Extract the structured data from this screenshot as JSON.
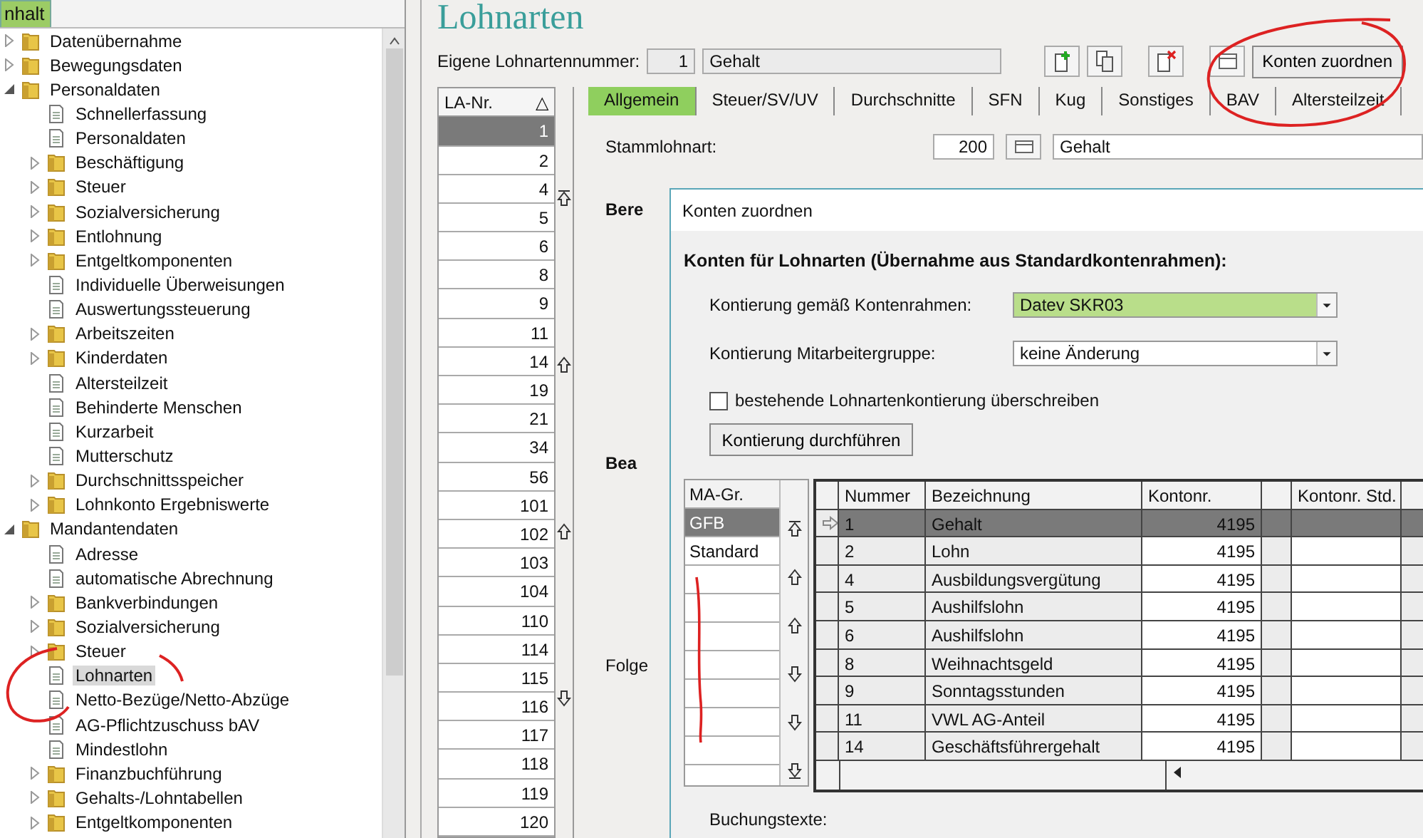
{
  "sidebar": {
    "tab": "nhalt",
    "items": [
      {
        "label": "Datenübernahme",
        "kind": "folder",
        "expanded": false,
        "selected": false
      },
      {
        "label": "Bewegungsdaten",
        "kind": "folder",
        "expanded": false,
        "selected": false
      },
      {
        "label": "Personaldaten",
        "kind": "folder",
        "expanded": true,
        "selected": false,
        "children": [
          {
            "label": "Schnellerfassung",
            "kind": "page",
            "selected": false
          },
          {
            "label": "Personaldaten",
            "kind": "page",
            "selected": false
          },
          {
            "label": "Beschäftigung",
            "kind": "folder",
            "expanded": false,
            "selected": false
          },
          {
            "label": "Steuer",
            "kind": "folder",
            "expanded": false,
            "selected": false
          },
          {
            "label": "Sozialversicherung",
            "kind": "folder",
            "expanded": false,
            "selected": false
          },
          {
            "label": "Entlohnung",
            "kind": "folder",
            "expanded": false,
            "selected": false
          },
          {
            "label": "Entgeltkomponenten",
            "kind": "folder",
            "expanded": false,
            "selected": false
          },
          {
            "label": "Individuelle Überweisungen",
            "kind": "page",
            "selected": false
          },
          {
            "label": "Auswertungssteuerung",
            "kind": "page",
            "selected": false
          },
          {
            "label": "Arbeitszeiten",
            "kind": "folder",
            "expanded": false,
            "selected": false
          },
          {
            "label": "Kinderdaten",
            "kind": "folder",
            "expanded": false,
            "selected": false
          },
          {
            "label": "Altersteilzeit",
            "kind": "page",
            "selected": false
          },
          {
            "label": "Behinderte Menschen",
            "kind": "page",
            "selected": false
          },
          {
            "label": "Kurzarbeit",
            "kind": "page",
            "selected": false
          },
          {
            "label": "Mutterschutz",
            "kind": "page",
            "selected": false
          },
          {
            "label": "Durchschnittsspeicher",
            "kind": "folder",
            "expanded": false,
            "selected": false
          },
          {
            "label": "Lohnkonto Ergebniswerte",
            "kind": "folder",
            "expanded": false,
            "selected": false
          }
        ]
      },
      {
        "label": "Mandantendaten",
        "kind": "folder",
        "expanded": true,
        "selected": false,
        "children": [
          {
            "label": "Adresse",
            "kind": "page",
            "selected": false
          },
          {
            "label": "automatische Abrechnung",
            "kind": "page",
            "selected": false
          },
          {
            "label": "Bankverbindungen",
            "kind": "folder",
            "expanded": false,
            "selected": false
          },
          {
            "label": "Sozialversicherung",
            "kind": "folder",
            "expanded": false,
            "selected": false
          },
          {
            "label": "Steuer",
            "kind": "folder",
            "expanded": false,
            "selected": false
          },
          {
            "label": "Lohnarten",
            "kind": "page",
            "selected": true
          },
          {
            "label": "Netto-Bezüge/Netto-Abzüge",
            "kind": "page",
            "selected": false
          },
          {
            "label": "AG-Pflichtzuschuss bAV",
            "kind": "page",
            "selected": false
          },
          {
            "label": "Mindestlohn",
            "kind": "page",
            "selected": false
          },
          {
            "label": "Finanzbuchführung",
            "kind": "folder",
            "expanded": false,
            "selected": false
          },
          {
            "label": "Gehalts-/Lohntabellen",
            "kind": "folder",
            "expanded": false,
            "selected": false
          },
          {
            "label": "Entgeltkomponenten",
            "kind": "folder",
            "expanded": false,
            "selected": false
          }
        ]
      }
    ]
  },
  "title": "Lohnarten",
  "header": {
    "number_label": "Eigene Lohnartennummer:",
    "number": "1",
    "name": "Gehalt",
    "assign_button": "Konten zuordnen"
  },
  "la_list": {
    "header": "LA-Nr.",
    "sort_icon": "△",
    "items": [
      {
        "label": "1",
        "selected": true
      },
      {
        "label": "2",
        "selected": false
      },
      {
        "label": "4",
        "selected": false
      },
      {
        "label": "5",
        "selected": false
      },
      {
        "label": "6",
        "selected": false
      },
      {
        "label": "8",
        "selected": false
      },
      {
        "label": "9",
        "selected": false
      },
      {
        "label": "11",
        "selected": false
      },
      {
        "label": "14",
        "selected": false
      },
      {
        "label": "19",
        "selected": false
      },
      {
        "label": "21",
        "selected": false
      },
      {
        "label": "34",
        "selected": false
      },
      {
        "label": "56",
        "selected": false
      },
      {
        "label": "101",
        "selected": false
      },
      {
        "label": "102",
        "selected": false
      },
      {
        "label": "103",
        "selected": false
      },
      {
        "label": "104",
        "selected": false
      },
      {
        "label": "110",
        "selected": false
      },
      {
        "label": "114",
        "selected": false
      },
      {
        "label": "115",
        "selected": false
      },
      {
        "label": "116",
        "selected": false
      },
      {
        "label": "117",
        "selected": false
      },
      {
        "label": "118",
        "selected": false
      },
      {
        "label": "119",
        "selected": false
      },
      {
        "label": "120",
        "selected": false
      }
    ]
  },
  "tabs": [
    {
      "label": "Allgemein",
      "selected": true
    },
    {
      "label": "Steuer/SV/UV",
      "selected": false
    },
    {
      "label": "Durchschnitte",
      "selected": false
    },
    {
      "label": "SFN",
      "selected": false
    },
    {
      "label": "Kug",
      "selected": false
    },
    {
      "label": "Sonstiges",
      "selected": false
    },
    {
      "label": "BAV",
      "selected": false
    },
    {
      "label": "Altersteilzeit",
      "selected": false
    }
  ],
  "general": {
    "base_label": "Stammlohnart:",
    "base_number": "200",
    "base_name": "Gehalt",
    "section_1": "Bere",
    "section_2": "Bea",
    "section_3": "Folge"
  },
  "dialog": {
    "title": "Konten zuordnen",
    "heading": "Konten für Lohnarten (Übernahme aus Standardkontenrahmen):",
    "fields": [
      {
        "label": "Kontierung gemäß Kontenrahmen:",
        "value": "Datev SKR03",
        "highlighted": true
      },
      {
        "label": "Kontierung Mitarbeitergruppe:",
        "value": "keine Änderung",
        "highlighted": false
      }
    ],
    "overwrite": {
      "label": "bestehende Lohnartenkontierung überschreiben",
      "checked": false
    },
    "run_button": "Kontierung durchführen",
    "groups": {
      "header": "MA-Gr.",
      "items": [
        {
          "label": "GFB",
          "selected": true
        },
        {
          "label": "Standard",
          "selected": false
        }
      ]
    },
    "table": {
      "columns": [
        "Nummer",
        "Bezeichnung",
        "Kontonr.",
        "Kontonr. Std."
      ],
      "rows": [
        {
          "number": "1",
          "name": "Gehalt",
          "account": "4195",
          "selected": true
        },
        {
          "number": "2",
          "name": "Lohn",
          "account": "4195",
          "selected": false
        },
        {
          "number": "4",
          "name": "Ausbildungsvergütung",
          "account": "4195",
          "selected": false
        },
        {
          "number": "5",
          "name": "Aushilfslohn",
          "account": "4195",
          "selected": false
        },
        {
          "number": "6",
          "name": "Aushilfslohn",
          "account": "4195",
          "selected": false
        },
        {
          "number": "8",
          "name": "Weihnachtsgeld",
          "account": "4195",
          "selected": false
        },
        {
          "number": "9",
          "name": "Sonntagsstunden",
          "account": "4195",
          "selected": false
        },
        {
          "number": "11",
          "name": "VWL AG-Anteil",
          "account": "4195",
          "selected": false
        },
        {
          "number": "14",
          "name": "Geschäftsführergehalt",
          "account": "4195",
          "selected": false
        }
      ]
    },
    "booking_label": "Buchungstexte:"
  }
}
